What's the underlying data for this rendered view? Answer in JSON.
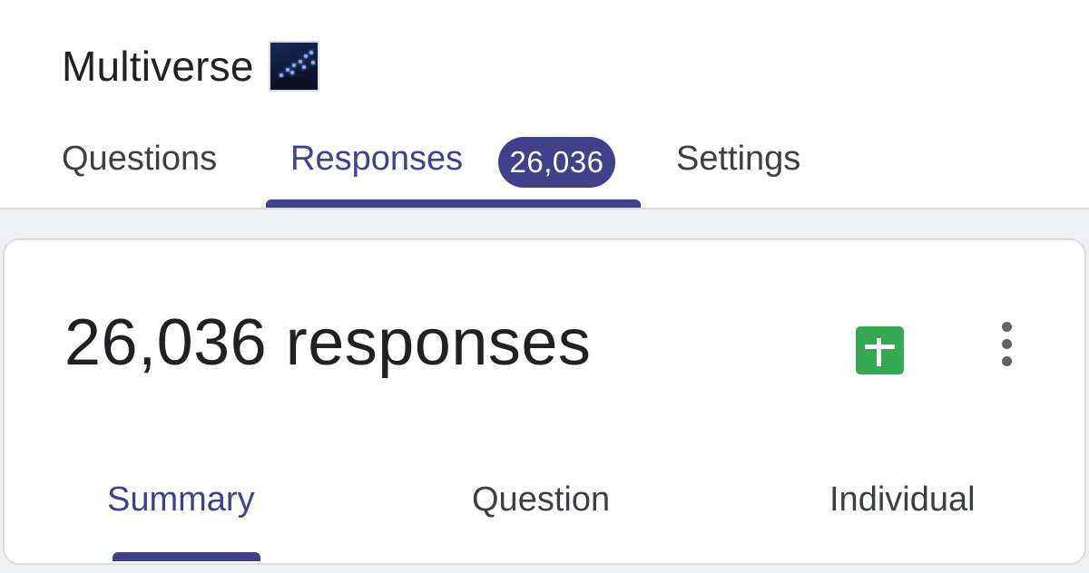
{
  "form": {
    "title": "Multiverse",
    "title_emoji": "milky-way-night-sky-icon"
  },
  "top_tabs": [
    {
      "label": "Questions",
      "active": false
    },
    {
      "label": "Responses",
      "active": true,
      "badge": "26,036"
    },
    {
      "label": "Settings",
      "active": false
    }
  ],
  "responses_card": {
    "count_text": "26,036 responses",
    "actions": [
      "google-sheets-icon",
      "more-vert-icon"
    ]
  },
  "sub_tabs": [
    {
      "label": "Summary",
      "active": true
    },
    {
      "label": "Question",
      "active": false
    },
    {
      "label": "Individual",
      "active": false
    }
  ],
  "colors": {
    "accent": "#3f418b",
    "sheets_green": "#34a853",
    "text_primary": "#202124",
    "text_secondary": "#3c4043",
    "page_background": "#f0f1f5"
  }
}
